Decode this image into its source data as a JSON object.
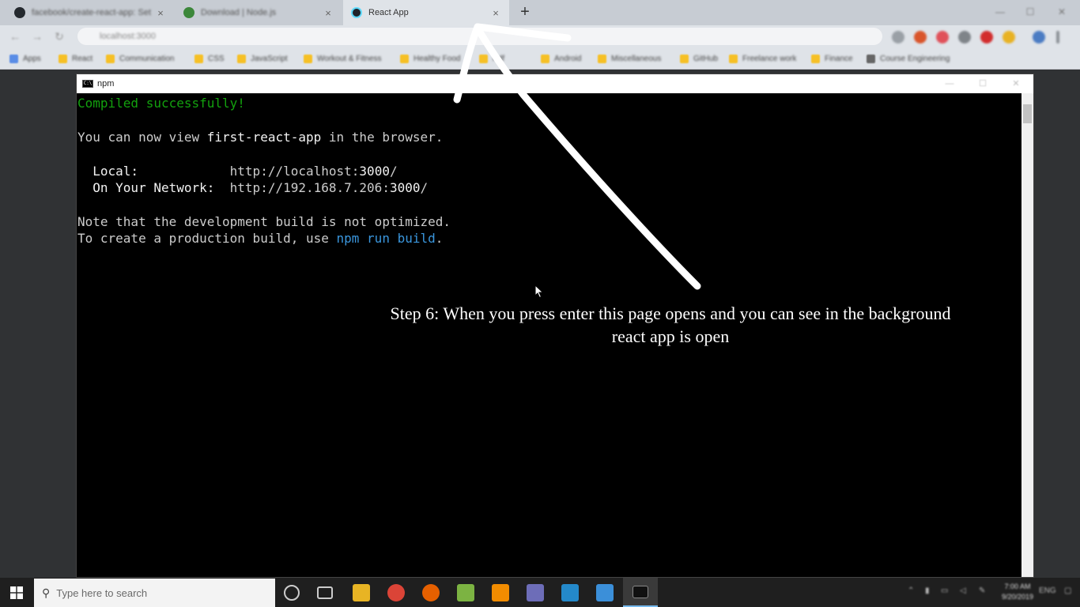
{
  "browser": {
    "tabs": [
      {
        "title": "facebook/create-react-app: Set",
        "icon": "github-icon",
        "color": "#24292e",
        "active": false
      },
      {
        "title": "Download | Node.js",
        "icon": "nodejs-icon",
        "color": "#3c873a",
        "active": false
      },
      {
        "title": "React App",
        "icon": "react-icon",
        "color": "#61dafb",
        "active": true
      }
    ],
    "tab_close": "×",
    "new_tab": "+",
    "window_controls": {
      "minimize": "—",
      "maximize": "☐",
      "close": "✕"
    },
    "nav": {
      "back": "←",
      "forward": "→",
      "reload": "↻"
    },
    "address_url": "localhost:3000",
    "bookmarks": [
      "Apps",
      "React",
      "Communication",
      "CSS",
      "JavaScript",
      "Workout & Fitness",
      "Healthy Food",
      "Pdf",
      "Android",
      "Miscellaneous",
      "GitHub",
      "Freelance work",
      "Finance",
      "Course Engineering"
    ]
  },
  "terminal": {
    "title": "npm",
    "icon_text": "C:\\",
    "controls": {
      "minimize": "—",
      "maximize": "☐",
      "close": "✕"
    },
    "lines": {
      "compiled": "Compiled successfully!",
      "view_prefix": "You can now view ",
      "app_name": "first-react-app",
      "view_suffix": " in the browser.",
      "local_label": "  Local:            ",
      "local_url_prefix": "http://localhost:",
      "local_port": "3000",
      "local_url_suffix": "/",
      "network_label": "  On Your Network:  ",
      "network_url_prefix": "http://192.168.7.206:",
      "network_port": "3000",
      "network_url_suffix": "/",
      "note": "Note that the development build is not optimized.",
      "prod_prefix": "To create a production build, use ",
      "prod_cmd": "npm run build",
      "prod_suffix": "."
    }
  },
  "annotation": {
    "caption_line1": "Step 6: When you press enter this page opens and you can see in the background",
    "caption_line2": "react app is open"
  },
  "taskbar": {
    "search_placeholder": "Type here to search",
    "clock_time": "7:00 AM",
    "clock_date": "9/20/2019",
    "language": "ENG"
  },
  "colors": {
    "terminal_green": "#13a10e",
    "terminal_cyan": "#3a96dd",
    "terminal_text": "#cccccc",
    "caption": "#ffffff"
  }
}
